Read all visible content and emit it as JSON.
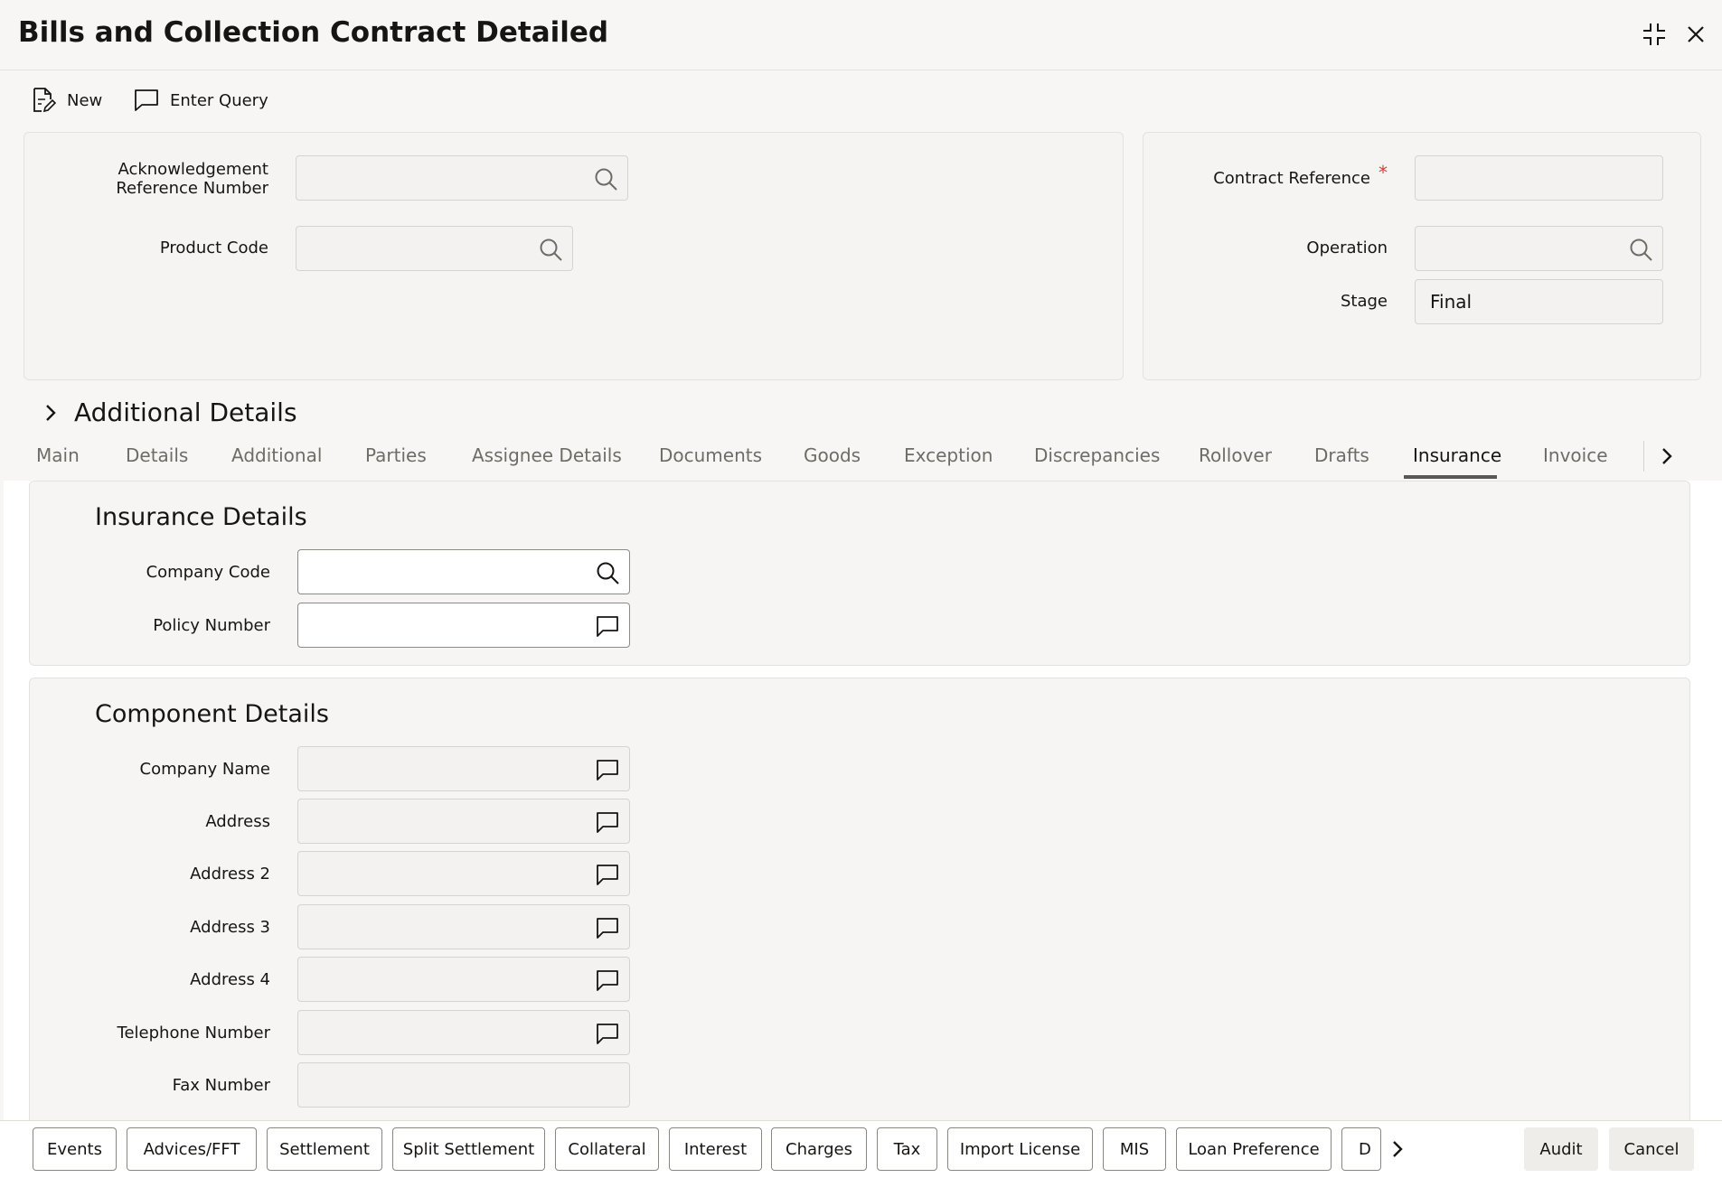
{
  "window": {
    "title": "Bills and Collection Contract Detailed"
  },
  "toolbar": {
    "new_label": "New",
    "enter_query_label": "Enter Query"
  },
  "header_form": {
    "ack_ref_label_line1": "Acknowledgement",
    "ack_ref_label_line2": "Reference Number",
    "ack_ref_value": "",
    "product_code_label": "Product Code",
    "product_code_value": "",
    "contract_reference_label": "Contract Reference",
    "contract_reference_required": "*",
    "contract_reference_value": "",
    "operation_label": "Operation",
    "operation_value": "",
    "stage_label": "Stage",
    "stage_value": "Final"
  },
  "additional_details": {
    "label": "Additional Details"
  },
  "tabs": [
    {
      "label": "Main",
      "active": false
    },
    {
      "label": "Details",
      "active": false
    },
    {
      "label": "Additional",
      "active": false
    },
    {
      "label": "Parties",
      "active": false
    },
    {
      "label": "Assignee Details",
      "active": false
    },
    {
      "label": "Documents",
      "active": false
    },
    {
      "label": "Goods",
      "active": false
    },
    {
      "label": "Exception",
      "active": false
    },
    {
      "label": "Discrepancies",
      "active": false
    },
    {
      "label": "Rollover",
      "active": false
    },
    {
      "label": "Drafts",
      "active": false
    },
    {
      "label": "Insurance",
      "active": true
    },
    {
      "label": "Invoice",
      "active": false
    }
  ],
  "insurance_details": {
    "heading": "Insurance Details",
    "company_code_label": "Company Code",
    "company_code_value": "",
    "policy_number_label": "Policy Number",
    "policy_number_value": ""
  },
  "component_details": {
    "heading": "Component Details",
    "company_name_label": "Company Name",
    "address_label": "Address",
    "address2_label": "Address 2",
    "address3_label": "Address 3",
    "address4_label": "Address 4",
    "telephone_label": "Telephone Number",
    "fax_label": "Fax Number"
  },
  "footer": {
    "buttons": [
      "Events",
      "Advices/FFT",
      "Settlement",
      "Split Settlement",
      "Collateral",
      "Interest",
      "Charges",
      "Tax",
      "Import License",
      "MIS",
      "Loan Preference",
      "D"
    ],
    "audit_label": "Audit",
    "cancel_label": "Cancel"
  },
  "colors": {
    "accent_underline": "#5a5856",
    "required_marker": "#c74634",
    "page_bg": "#f7f6f4"
  }
}
